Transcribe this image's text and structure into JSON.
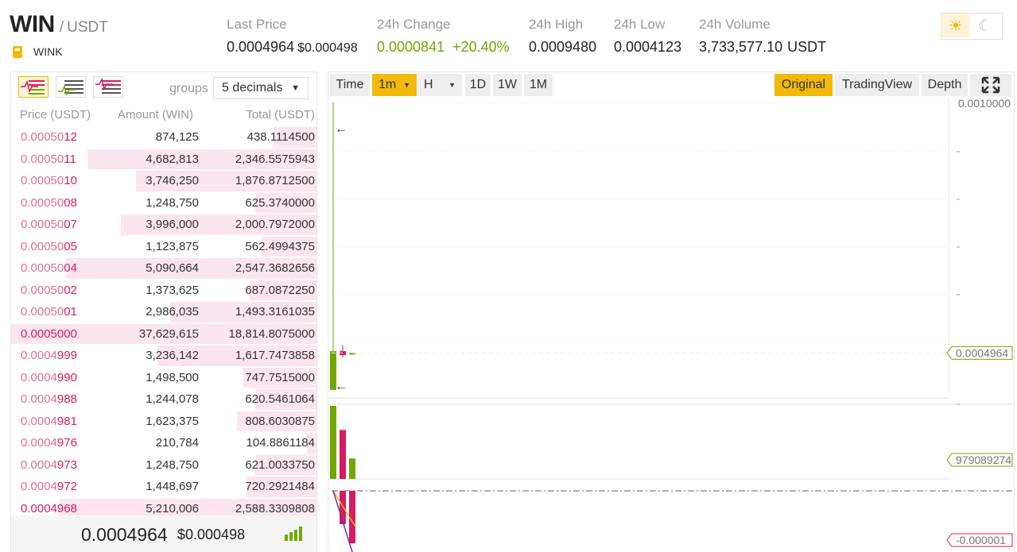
{
  "header": {
    "base": "WIN",
    "quote": "USDT",
    "token_name": "WINK",
    "stats": [
      {
        "label": "Last Price",
        "value": "0.0004964",
        "sub": "$0.000498"
      },
      {
        "label": "24h Change",
        "value": "0.0000841",
        "sub": "+20.40%"
      },
      {
        "label": "24h High",
        "value": "0.0009480"
      },
      {
        "label": "24h Low",
        "value": "0.0004123"
      },
      {
        "label": "24h Volume",
        "value": "3,733,577.10",
        "sub": "USDT"
      }
    ]
  },
  "theme": {
    "light_icon": "sun-icon",
    "dark_icon": "moon-icon",
    "active": "light"
  },
  "orderbook": {
    "groups_label": "groups",
    "decimals": "5 decimals",
    "columns": [
      "Price (USDT)",
      "Amount (WIN)",
      "Total (USDT)"
    ],
    "rows": [
      {
        "dim": "0.00050",
        "strong": "12",
        "amount": "874,125",
        "total": "438.1114500",
        "depth": 0.14
      },
      {
        "dim": "0.00050",
        "strong": "11",
        "amount": "4,682,813",
        "total": "2,346.5575943",
        "depth": 0.75
      },
      {
        "dim": "0.00050",
        "strong": "10",
        "amount": "3,746,250",
        "total": "1,876.8712500",
        "depth": 0.59
      },
      {
        "dim": "0.00050",
        "strong": "08",
        "amount": "1,248,750",
        "total": "625.3740000",
        "depth": 0.2
      },
      {
        "dim": "0.00050",
        "strong": "07",
        "amount": "3,996,000",
        "total": "2,000.7972000",
        "depth": 0.64
      },
      {
        "dim": "0.00050",
        "strong": "05",
        "amount": "1,123,875",
        "total": "562.4994375",
        "depth": 0.18
      },
      {
        "dim": "0.00050",
        "strong": "04",
        "amount": "5,090,664",
        "total": "2,547.3682656",
        "depth": 0.82
      },
      {
        "dim": "0.00050",
        "strong": "02",
        "amount": "1,373,625",
        "total": "687.0872250",
        "depth": 0.22
      },
      {
        "dim": "0.00050",
        "strong": "01",
        "amount": "2,986,035",
        "total": "1,493.3161035",
        "depth": 0.48
      },
      {
        "dim": "",
        "strong": "0.0005000",
        "amount": "37,629,615",
        "total": "18,814.8075000",
        "depth": 1.0
      },
      {
        "dim": "0.0004",
        "strong": "999",
        "amount": "3,236,142",
        "total": "1,617.7473858",
        "depth": 0.52
      },
      {
        "dim": "0.0004",
        "strong": "990",
        "amount": "1,498,500",
        "total": "747.7515000",
        "depth": 0.24
      },
      {
        "dim": "0.0004",
        "strong": "988",
        "amount": "1,244,078",
        "total": "620.5461064",
        "depth": 0.2
      },
      {
        "dim": "0.0004",
        "strong": "981",
        "amount": "1,623,375",
        "total": "808.6030875",
        "depth": 0.26
      },
      {
        "dim": "0.0004",
        "strong": "976",
        "amount": "210,784",
        "total": "104.8861184",
        "depth": 0.03
      },
      {
        "dim": "0.0004",
        "strong": "973",
        "amount": "1,248,750",
        "total": "621.0033750",
        "depth": 0.2
      },
      {
        "dim": "0.0004",
        "strong": "972",
        "amount": "1,448,697",
        "total": "720.2921484",
        "depth": 0.23
      },
      {
        "dim": "",
        "strong": "0.0004968",
        "amount": "5,210,006",
        "total": "2,588.3309808",
        "depth": 0.84
      }
    ],
    "footer_price": "0.0004964",
    "footer_usd": "$0.000498"
  },
  "chart_toolbar": {
    "buttons": [
      "Time",
      "1m",
      "H",
      "1D",
      "1W",
      "1M"
    ],
    "active_interval": "1m",
    "views": [
      "Original",
      "TradingView",
      "Depth"
    ],
    "active_view": "Original",
    "fullscreen_icon": "fullscreen-icon"
  },
  "chart_data": {
    "type": "candlestick",
    "price_axis": {
      "top_label": "0.0010000"
    },
    "price_label": "0.0004964",
    "volume_label": "979089274",
    "indicator_label": "-0.000001",
    "candles": [
      {
        "open": 0.000422,
        "close": 0.0005,
        "high": 0.001,
        "low": 0.000422,
        "dir": "up"
      },
      {
        "open": 0.0005,
        "close": 0.000492,
        "high": 0.000512,
        "low": 0.000488,
        "dir": "down"
      },
      {
        "open": 0.0004964,
        "close": 0.0004964,
        "high": 0.0004964,
        "low": 0.0004964,
        "dir": "flat"
      }
    ],
    "volumes": [
      1.0,
      0.67,
      0.28
    ],
    "volume_colors": [
      "#70a800",
      "#d81b60",
      "#70a800"
    ]
  },
  "colors": {
    "accent": "#f0b90b",
    "up": "#70a800",
    "down": "#d81b60"
  }
}
